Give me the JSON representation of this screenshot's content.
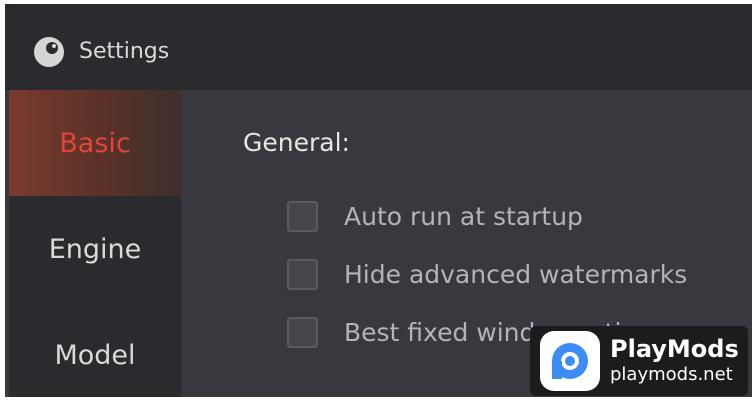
{
  "window": {
    "title": "Settings",
    "app_icon": "app-logo-icon"
  },
  "sidebar": {
    "items": [
      {
        "label": "Basic",
        "active": true
      },
      {
        "label": "Engine",
        "active": false
      },
      {
        "label": "Model",
        "active": false
      }
    ]
  },
  "main": {
    "section_heading": "General:",
    "options": [
      {
        "label": "Auto run at startup",
        "checked": false
      },
      {
        "label": "Hide advanced watermarks",
        "checked": false
      },
      {
        "label": "Best fixed window ratio",
        "checked": false
      }
    ]
  },
  "watermark": {
    "name": "PlayMods",
    "url": "playmods.net",
    "logo_icon": "playmods-logo-icon"
  },
  "colors": {
    "accent": "#e0453a",
    "window_bg": "#38383e",
    "sidebar_bg": "#2b2b2f"
  }
}
